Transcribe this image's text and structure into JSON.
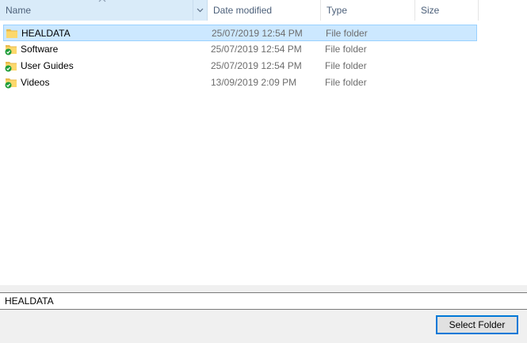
{
  "columns": {
    "name": "Name",
    "date": "Date modified",
    "type": "Type",
    "size": "Size"
  },
  "icons": {
    "sort": "sort-ascending-icon",
    "dropdown": "chevron-down-icon",
    "folder": "folder-icon",
    "sync": "sync-check-icon"
  },
  "files": [
    {
      "name": "HEALDATA",
      "date": "25/07/2019 12:54 PM",
      "type": "File folder",
      "selected": true,
      "synced": false
    },
    {
      "name": "Software",
      "date": "25/07/2019 12:54 PM",
      "type": "File folder",
      "selected": false,
      "synced": true
    },
    {
      "name": "User Guides",
      "date": "25/07/2019 12:54 PM",
      "type": "File folder",
      "selected": false,
      "synced": true
    },
    {
      "name": "Videos",
      "date": "13/09/2019 2:09 PM",
      "type": "File folder",
      "selected": false,
      "synced": true
    }
  ],
  "footer": {
    "folder_name_value": "HEALDATA",
    "select_button_label": "Select Folder"
  },
  "colors": {
    "selection_bg": "#cce8ff",
    "selection_border": "#99d1ff",
    "accent": "#0078d7"
  }
}
